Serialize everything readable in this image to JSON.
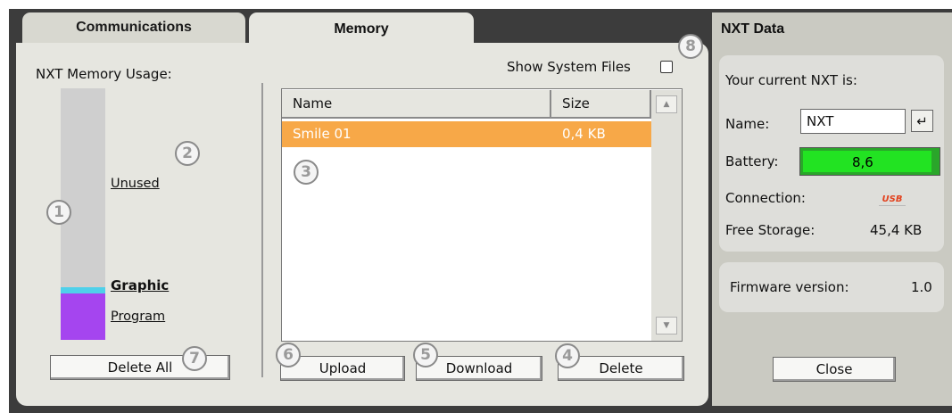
{
  "tabs": [
    {
      "label": "Communications",
      "active": false
    },
    {
      "label": "Memory",
      "active": true
    }
  ],
  "memory": {
    "usage_label": "NXT Memory Usage:",
    "show_system_files_label": "Show System Files",
    "show_system_files_checked": false,
    "legend": {
      "unused": "Unused",
      "graphic": "Graphic",
      "program": "Program"
    },
    "usage_fractions": {
      "unused": 0.79,
      "graphic": 0.03,
      "program": 0.18
    },
    "colors": {
      "unused": "#cfcfcf",
      "graphic": "#4fd0ea",
      "program": "#a545ef",
      "selected_row": "#f7a848"
    },
    "columns": [
      "Name",
      "Size"
    ],
    "files": [
      {
        "name": "Smile 01",
        "size": "0,4 KB",
        "selected": true
      }
    ],
    "buttons": {
      "delete_all": "Delete All",
      "upload": "Upload",
      "download": "Download",
      "delete": "Delete"
    }
  },
  "callouts": [
    "1",
    "2",
    "3",
    "4",
    "5",
    "6",
    "7",
    "8"
  ],
  "nxt_data": {
    "title": "NXT Data",
    "current_label": "Your current NXT is:",
    "name_label": "Name:",
    "name_value": "NXT",
    "battery_label": "Battery:",
    "battery_value": "8,6",
    "battery_color": "#22e322",
    "connection_label": "Connection:",
    "connection_icon": "usb-icon",
    "connection_icon_text": "USB",
    "free_storage_label": "Free Storage:",
    "free_storage_value": "45,4 KB",
    "firmware_label": "Firmware version:",
    "firmware_value": "1.0",
    "close_label": "Close"
  }
}
